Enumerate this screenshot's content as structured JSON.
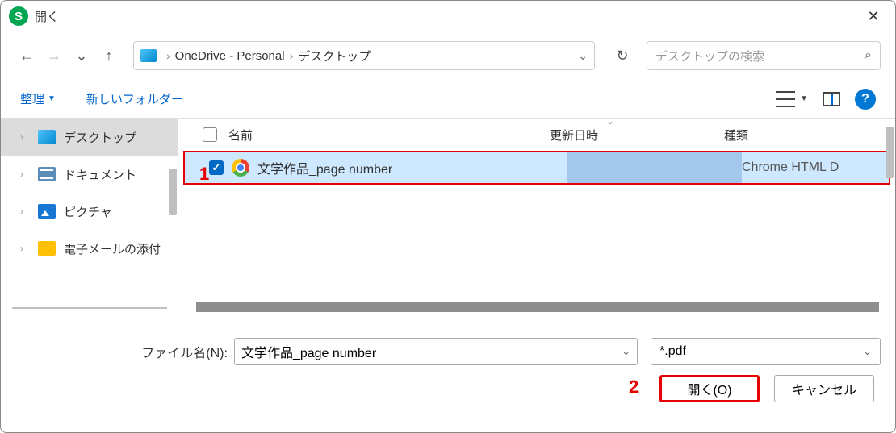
{
  "window": {
    "title": "開く"
  },
  "nav": {},
  "breadcrumb": {
    "seg1": "OneDrive - Personal",
    "seg2": "デスクトップ"
  },
  "search": {
    "placeholder": "デスクトップの検索"
  },
  "toolbar": {
    "organize": "整理",
    "newfolder": "新しいフォルダー"
  },
  "sidebar": {
    "items": [
      {
        "label": "デスクトップ"
      },
      {
        "label": "ドキュメント"
      },
      {
        "label": "ピクチャ"
      },
      {
        "label": "電子メールの添付"
      }
    ]
  },
  "columns": {
    "name": "名前",
    "date": "更新日時",
    "type": "種類"
  },
  "files": [
    {
      "name": "文学作品_page number",
      "type": "Chrome HTML D"
    }
  ],
  "annotations": {
    "one": "1",
    "two": "2"
  },
  "footer": {
    "label": "ファイル名(N):",
    "filename": "文学作品_page number",
    "filter": "*.pdf",
    "open": "開く(O)",
    "cancel": "キャンセル"
  }
}
